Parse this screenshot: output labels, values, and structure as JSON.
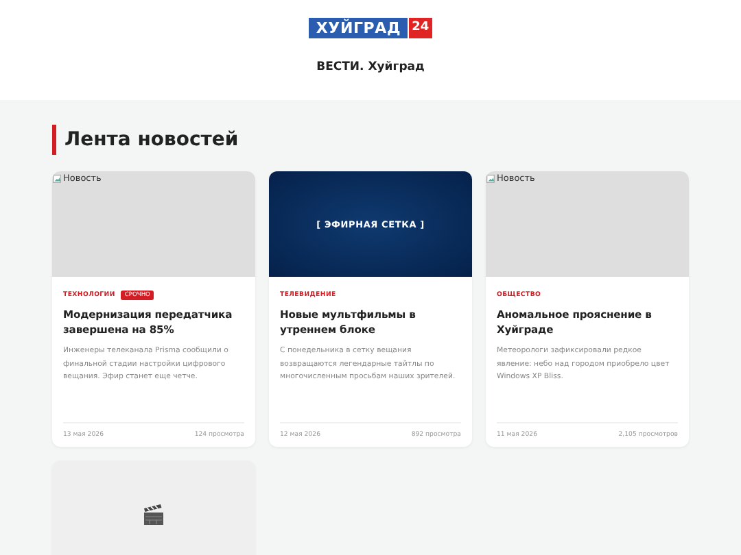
{
  "header": {
    "logo": {
      "text": "ХУЙГРАД",
      "number": "24"
    },
    "site_title": "ВЕСТИ. Хуйград"
  },
  "section": {
    "title": "Лента новостей"
  },
  "cards": [
    {
      "media": {
        "kind": "broken_image",
        "alt": "Новость"
      },
      "category": "ТЕХНОЛОГИИ",
      "badge": "СРОЧНО",
      "title": "Модернизация передатчика завершена на 85%",
      "excerpt": "Инженеры телеканала Prisma сообщили о финальной стадии настройки цифрового вещания. Эфир станет еще четче.",
      "date": "13 мая 2026",
      "views": "124 просмотра"
    },
    {
      "media": {
        "kind": "banner",
        "text": "[ ЭФИРНАЯ СЕТКА ]"
      },
      "category": "ТЕЛЕВИДЕНИЕ",
      "title": "Новые мультфильмы в утреннем блоке",
      "excerpt": "С понедельника в сетку вещания возвращаются легендарные тайтлы по многочисленным просьбам наших зрителей.",
      "date": "12 мая 2026",
      "views": "892 просмотра"
    },
    {
      "media": {
        "kind": "broken_image",
        "alt": "Новость"
      },
      "category": "ОБЩЕСТВО",
      "title": "Аномальное прояснение в Хуйграде",
      "excerpt": "Метеорологи зафиксировали редкое явление: небо над городом приобрело цвет Windows XP Bliss.",
      "date": "11 мая 2026",
      "views": "2,105 просмотров"
    },
    {
      "media": {
        "kind": "clapper"
      }
    }
  ]
}
